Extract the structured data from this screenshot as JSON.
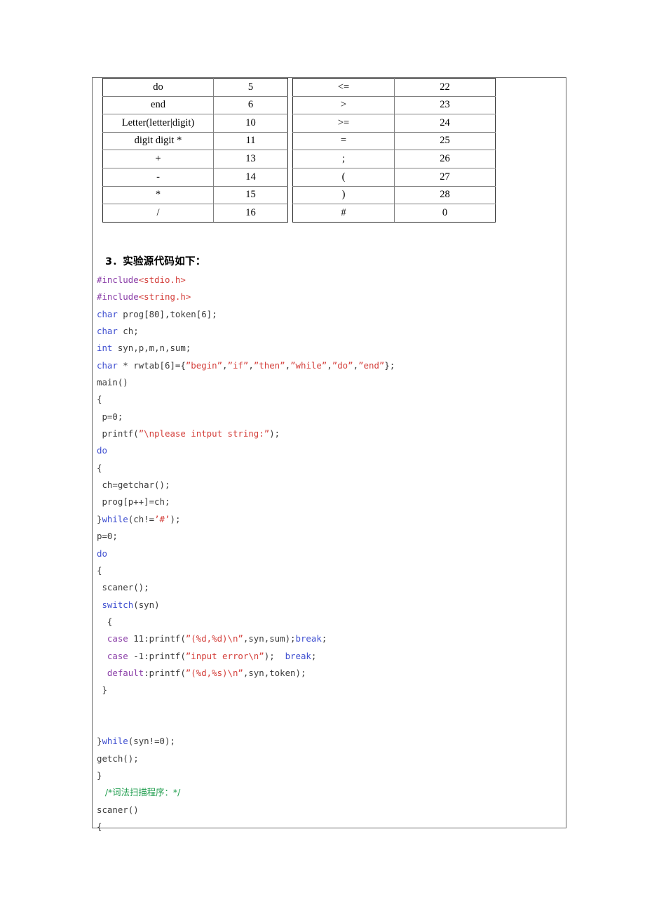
{
  "document": {
    "heading": "3．实验源代码如下："
  },
  "tables": {
    "left": {
      "rows": [
        {
          "symbol": "do",
          "code": "5"
        },
        {
          "symbol": "end",
          "code": "6"
        },
        {
          "symbol": "Letter(letter|digit)",
          "code": "10"
        },
        {
          "symbol": "digit digit *",
          "code": "11"
        },
        {
          "symbol": "+",
          "code": "13"
        },
        {
          "symbol": "-",
          "code": "14"
        },
        {
          "symbol": "*",
          "code": "15"
        },
        {
          "symbol": "/",
          "code": "16"
        }
      ]
    },
    "right": {
      "rows": [
        {
          "symbol": "<=",
          "code": "22"
        },
        {
          "symbol": ">",
          "code": "23"
        },
        {
          "symbol": ">=",
          "code": "24"
        },
        {
          "symbol": "=",
          "code": "25"
        },
        {
          "symbol": ";",
          "code": "26"
        },
        {
          "symbol": "(",
          "code": "27"
        },
        {
          "symbol": ")",
          "code": "28"
        },
        {
          "symbol": "#",
          "code": "0"
        }
      ]
    }
  },
  "colors": {
    "preprocessor": "#8b3fa8",
    "keyword": "#3f4fd0",
    "string": "#d4403c",
    "comment": "#1f9d4d",
    "plain": "#3b3b3b",
    "table_border": "#808080",
    "page_border": "#6b6b6b"
  },
  "code": {
    "lines": [
      [
        {
          "t": "#include",
          "c": "pre"
        },
        {
          "t": "<stdio.h>",
          "c": "str"
        }
      ],
      [
        {
          "t": "#include",
          "c": "pre"
        },
        {
          "t": "<string.h>",
          "c": "str"
        }
      ],
      [
        {
          "t": "char",
          "c": "kw"
        },
        {
          "t": " prog[80],token[6];",
          "c": "pln"
        }
      ],
      [
        {
          "t": "char",
          "c": "kw"
        },
        {
          "t": " ch;",
          "c": "pln"
        }
      ],
      [
        {
          "t": "int",
          "c": "kw"
        },
        {
          "t": " syn,p,m,n,sum;",
          "c": "pln"
        }
      ],
      [
        {
          "t": "char",
          "c": "kw"
        },
        {
          "t": " * rwtab[6]={",
          "c": "pln"
        },
        {
          "t": "”begin”",
          "c": "str"
        },
        {
          "t": ",",
          "c": "pln"
        },
        {
          "t": "”if”",
          "c": "str"
        },
        {
          "t": ",",
          "c": "pln"
        },
        {
          "t": "”then”",
          "c": "str"
        },
        {
          "t": ",",
          "c": "pln"
        },
        {
          "t": "”while”",
          "c": "str"
        },
        {
          "t": ",",
          "c": "pln"
        },
        {
          "t": "”do”",
          "c": "str"
        },
        {
          "t": ",",
          "c": "pln"
        },
        {
          "t": "”end”",
          "c": "str"
        },
        {
          "t": "};",
          "c": "pln"
        }
      ],
      [
        {
          "t": "main()",
          "c": "pln"
        }
      ],
      [
        {
          "t": "{",
          "c": "pln"
        }
      ],
      [
        {
          "t": " p=0;",
          "c": "pln"
        }
      ],
      [
        {
          "t": " printf(",
          "c": "pln"
        },
        {
          "t": "”\\nplease intput string:”",
          "c": "str"
        },
        {
          "t": ");",
          "c": "pln"
        }
      ],
      [
        {
          "t": "do",
          "c": "kw"
        }
      ],
      [
        {
          "t": "{",
          "c": "pln"
        }
      ],
      [
        {
          "t": " ch=getchar();",
          "c": "pln"
        }
      ],
      [
        {
          "t": " prog[p++]=ch;",
          "c": "pln"
        }
      ],
      [
        {
          "t": "}",
          "c": "pln"
        },
        {
          "t": "while",
          "c": "kw"
        },
        {
          "t": "(ch!=",
          "c": "pln"
        },
        {
          "t": "’#’",
          "c": "str"
        },
        {
          "t": ");",
          "c": "pln"
        }
      ],
      [
        {
          "t": "p=0;",
          "c": "pln"
        }
      ],
      [
        {
          "t": "do",
          "c": "kw"
        }
      ],
      [
        {
          "t": "{",
          "c": "pln"
        }
      ],
      [
        {
          "t": " scaner();",
          "c": "pln"
        }
      ],
      [
        {
          "t": " ",
          "c": "pln"
        },
        {
          "t": "switch",
          "c": "kw"
        },
        {
          "t": "(syn)",
          "c": "pln"
        }
      ],
      [
        {
          "t": "  {",
          "c": "pln"
        }
      ],
      [
        {
          "t": "  ",
          "c": "pln"
        },
        {
          "t": "case",
          "c": "pre"
        },
        {
          "t": " 11:printf(",
          "c": "pln"
        },
        {
          "t": "”(%d,%d)\\n”",
          "c": "str"
        },
        {
          "t": ",syn,sum);",
          "c": "pln"
        },
        {
          "t": "break",
          "c": "kw"
        },
        {
          "t": ";",
          "c": "pln"
        }
      ],
      [
        {
          "t": "  ",
          "c": "pln"
        },
        {
          "t": "case",
          "c": "pre"
        },
        {
          "t": " -1:printf(",
          "c": "pln"
        },
        {
          "t": "”input error\\n”",
          "c": "str"
        },
        {
          "t": ");  ",
          "c": "pln"
        },
        {
          "t": "break",
          "c": "kw"
        },
        {
          "t": ";",
          "c": "pln"
        }
      ],
      [
        {
          "t": "  ",
          "c": "pln"
        },
        {
          "t": "default",
          "c": "pre"
        },
        {
          "t": ":printf(",
          "c": "pln"
        },
        {
          "t": "”(%d,%s)\\n”",
          "c": "str"
        },
        {
          "t": ",syn,token);",
          "c": "pln"
        }
      ],
      [
        {
          "t": " }",
          "c": "pln"
        }
      ],
      [
        {
          "t": "",
          "c": "pln"
        }
      ],
      [
        {
          "t": "",
          "c": "pln"
        }
      ],
      [
        {
          "t": "}",
          "c": "pln"
        },
        {
          "t": "while",
          "c": "kw"
        },
        {
          "t": "(syn!=0);",
          "c": "pln"
        }
      ],
      [
        {
          "t": "getch();",
          "c": "pln"
        }
      ],
      [
        {
          "t": "}",
          "c": "pln"
        }
      ],
      [
        {
          "t": "   /*词法扫描程序：*/",
          "c": "cmt",
          "cjk": true
        }
      ],
      [
        {
          "t": "scaner()",
          "c": "pln"
        }
      ],
      [
        {
          "t": "{",
          "c": "pln"
        }
      ]
    ]
  }
}
